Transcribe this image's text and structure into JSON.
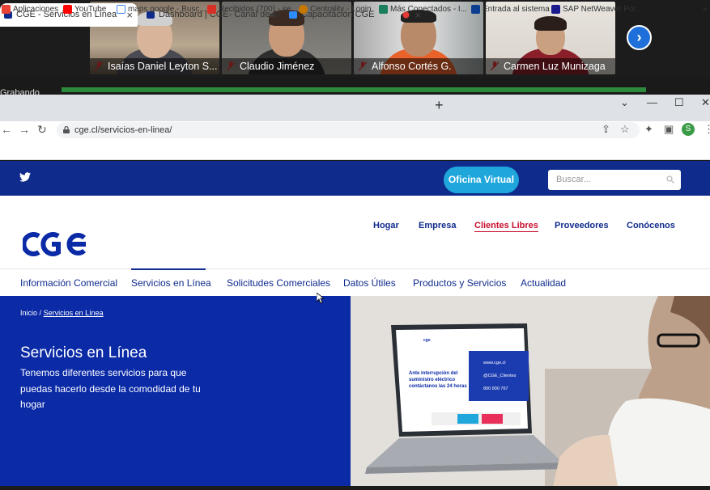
{
  "call": {
    "participants": [
      {
        "name": "Isaías Daniel Leyton S..."
      },
      {
        "name": "Claudio Jiménez"
      },
      {
        "name": "Alfonso Cortés G."
      },
      {
        "name": "Carmen Luz Munizaga"
      }
    ],
    "recording_label": "Grabando"
  },
  "browser": {
    "tabs": [
      {
        "label": "CGE - Servicios en Línea",
        "close": "×"
      },
      {
        "label": "Dashboard | CGE- Canal de Auto",
        "close": "×"
      },
      {
        "label": "Capacitación CGE",
        "close": "×"
      }
    ],
    "new_tab": "+",
    "controls": {
      "dropdown": "⌄",
      "minimize": "—",
      "maximize": "☐",
      "close": "✕"
    },
    "nav": {
      "back": "←",
      "forward": "→",
      "reload": "↻"
    },
    "url": "cge.cl/servicios-en-linea/",
    "bookmarks": [
      {
        "label": "Aplicaciones",
        "color": "#ea4335"
      },
      {
        "label": "YouTube",
        "color": "#ff0000"
      },
      {
        "label": "maps google - Busc...",
        "color": "#4285f4"
      },
      {
        "label": "Recibidos (700) - se...",
        "color": "#d93025"
      },
      {
        "label": "Centrality - Login",
        "color": "#c77700"
      },
      {
        "label": "Más Conectados - I...",
        "color": "#1a7f5a"
      },
      {
        "label": "Entrada al sistema",
        "color": "#0b3d91"
      },
      {
        "label": "SAP NetWeaver Por...",
        "color": "#1a1a8c"
      }
    ],
    "more": "»",
    "profile_initial": "S"
  },
  "site": {
    "oficina_label": "Oficina Virtual",
    "search_placeholder": "Buscar...",
    "main_nav": [
      "Hogar",
      "Empresa",
      "Clientes Libres",
      "Proveedores",
      "Conócenos"
    ],
    "sub_nav": [
      "Información Comercial",
      "Servicios en Línea",
      "Solicitudes Comerciales",
      "Datos Útiles",
      "Productos y Servicios",
      "Actualidad"
    ],
    "breadcrumb": {
      "home": "Inicio",
      "sep": "/",
      "current": "Servicios en Línea"
    },
    "hero": {
      "title": "Servicios en Línea",
      "description": "Tenemos diferentes servicios para que puedas hacerlo desde la comodidad de tu hogar"
    },
    "laptop_screen": {
      "brand": "cge",
      "headline": "Ante interrupción del suministro eléctrico contáctanos las 24 horas",
      "web": "www.cge.cl",
      "twitter": "@CGE_Clientes",
      "phone": "800 800 767"
    }
  },
  "colors": {
    "brand_blue": "#0f2b8c",
    "hero_blue": "#0a2aa6",
    "accent_cyan": "#1fa7dc",
    "active_red": "#c8102e"
  }
}
